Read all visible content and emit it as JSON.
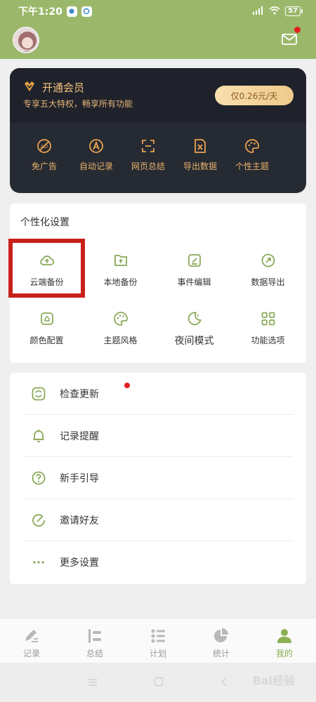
{
  "status_bar": {
    "time": "下午1:20",
    "signal": "4G",
    "battery": "57"
  },
  "vip": {
    "title": "开通会员",
    "subtitle": "专享五大特权，畅享所有功能",
    "price_button": "仅0.26元/天",
    "features": [
      "免广告",
      "自动记录",
      "网页总结",
      "导出数据",
      "个性主题"
    ]
  },
  "settings": {
    "title": "个性化设置",
    "items": [
      "云端备份",
      "本地备份",
      "事件编辑",
      "数据导出",
      "颜色配置",
      "主题风格",
      "夜间模式",
      "功能选项"
    ]
  },
  "menu": {
    "items": [
      "检查更新",
      "记录提醒",
      "新手引导",
      "邀请好友",
      "更多设置"
    ]
  },
  "tabs": [
    "记录",
    "总结",
    "计划",
    "统计",
    "我的"
  ],
  "colors": {
    "accent": "#9bb86a",
    "vip_gold": "#f5c37e",
    "highlight": "#c8201a",
    "icon_green": "#8aaa59"
  },
  "watermark": "Bai经验"
}
